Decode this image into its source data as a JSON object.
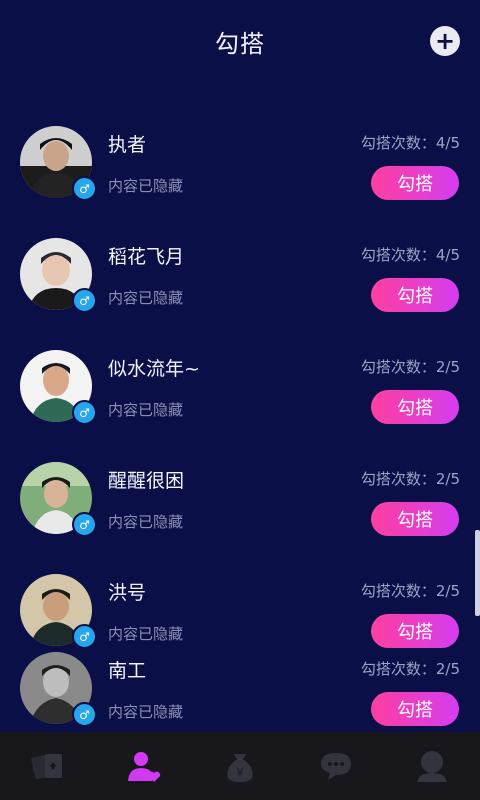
{
  "header": {
    "title": "勾搭",
    "add_icon": "plus-icon"
  },
  "colors": {
    "background": "#0a0f47",
    "button_gradient_start": "#ff3fa0",
    "button_gradient_end": "#d43df0",
    "gender_badge": "#27a6ee",
    "active_tab": "#d13af0"
  },
  "users": [
    {
      "name": "执者",
      "count_text": "勾搭次数：4/5",
      "status": "内容已隐藏",
      "button": "勾搭",
      "gender_icon": "male-icon"
    },
    {
      "name": "稻花飞月",
      "count_text": "勾搭次数：4/5",
      "status": "内容已隐藏",
      "button": "勾搭",
      "gender_icon": "male-icon"
    },
    {
      "name": "似水流年~",
      "count_text": "勾搭次数：2/5",
      "status": "内容已隐藏",
      "button": "勾搭",
      "gender_icon": "male-icon"
    },
    {
      "name": "醒醒很困",
      "count_text": "勾搭次数：2/5",
      "status": "内容已隐藏",
      "button": "勾搭",
      "gender_icon": "male-icon"
    },
    {
      "name": "洪号",
      "count_text": "勾搭次数：2/5",
      "status": "内容已隐藏",
      "button": "勾搭",
      "gender_icon": "male-icon"
    },
    {
      "name": "南工",
      "count_text": "勾搭次数：2/5",
      "status": "内容已隐藏",
      "button": "勾搭",
      "gender_icon": "male-icon"
    }
  ],
  "tabs": [
    {
      "icon": "cards-icon",
      "active": false
    },
    {
      "icon": "user-heart-icon",
      "active": true
    },
    {
      "icon": "money-bag-icon",
      "active": false
    },
    {
      "icon": "chat-bubble-icon",
      "active": false
    },
    {
      "icon": "profile-icon",
      "active": false
    }
  ]
}
